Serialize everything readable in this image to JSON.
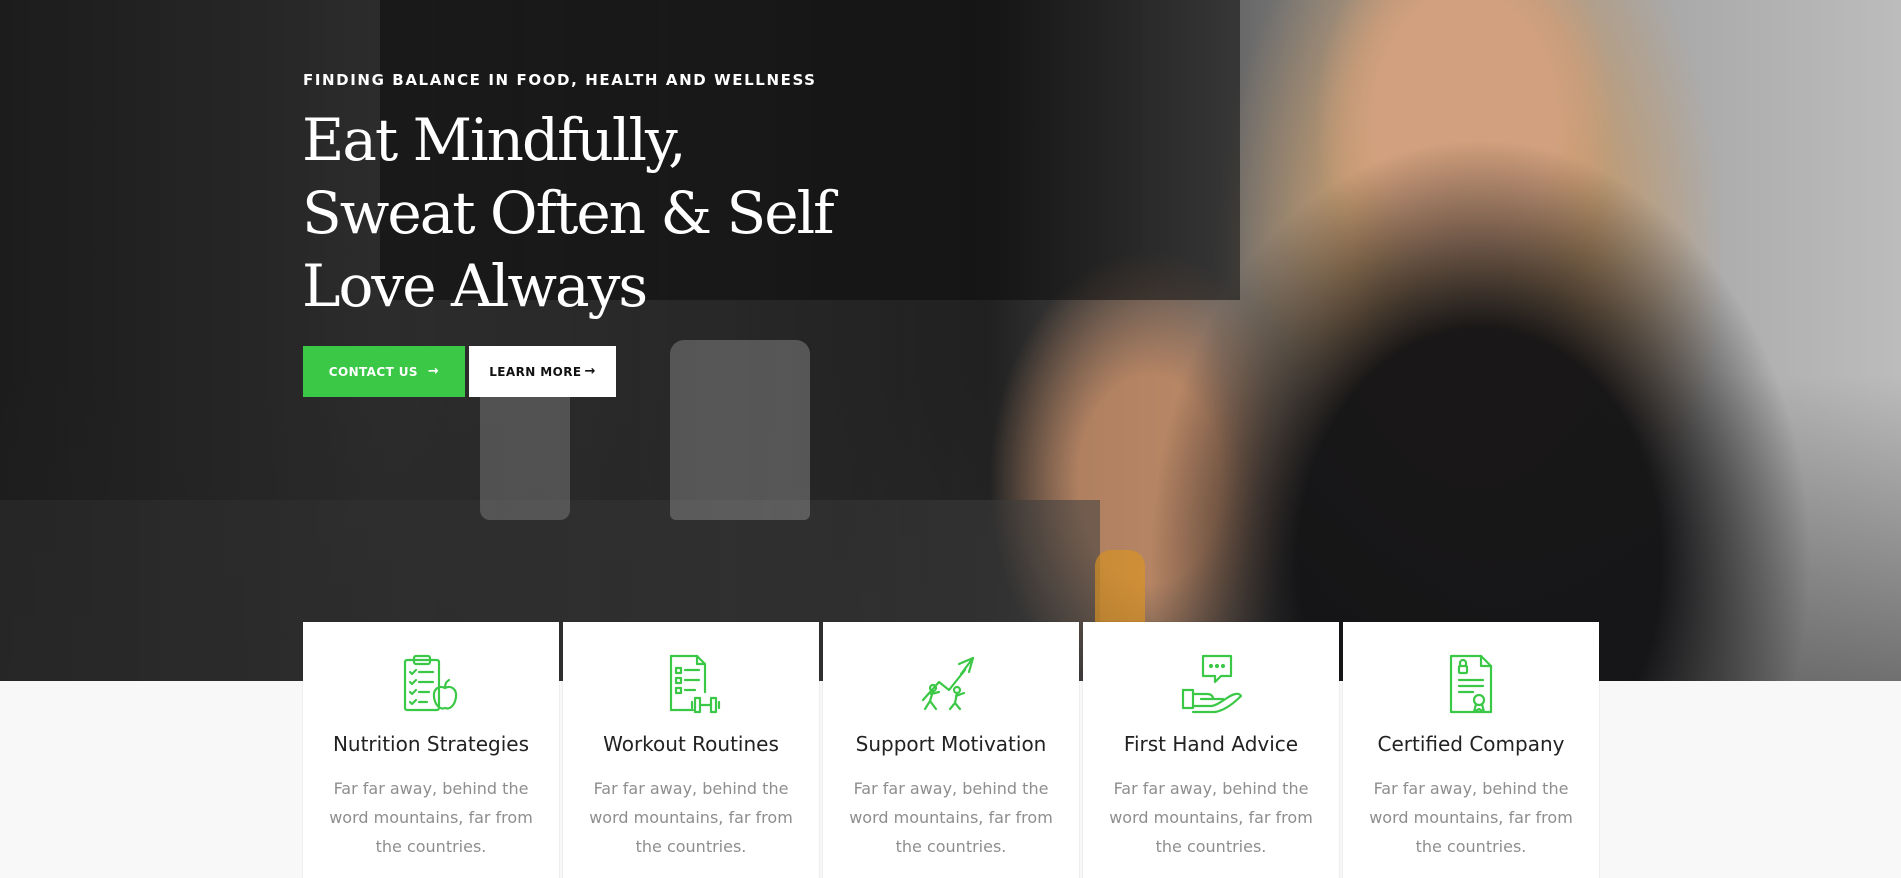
{
  "theme": {
    "accent": "#3cc847",
    "text_dark": "#222222",
    "text_muted": "#8e8e8e"
  },
  "hero": {
    "subtitle": "FINDING BALANCE IN FOOD, HEALTH AND WELLNESS",
    "headline_lines": [
      "Eat Mindfully,",
      "Sweat Often & Self",
      "Love Always"
    ],
    "buttons": {
      "contact": {
        "label": "CONTACT US",
        "arrow": "→"
      },
      "learn": {
        "label": "LEARN MORE",
        "arrow": "→"
      }
    }
  },
  "features": [
    {
      "icon": "clipboard-apple-icon",
      "title": "Nutrition Strategies",
      "text": "Far far away, behind the word mountains, far from the countries."
    },
    {
      "icon": "checklist-dumbbell-icon",
      "title": "Workout Routines",
      "text": "Far far away, behind the word mountains, far from the countries."
    },
    {
      "icon": "climbing-arrow-icon",
      "title": "Support Motivation",
      "text": "Far far away, behind the word mountains, far from the countries."
    },
    {
      "icon": "hand-chat-icon",
      "title": "First Hand Advice",
      "text": "Far far away, behind the word mountains, far from the countries."
    },
    {
      "icon": "certificate-icon",
      "title": "Certified Company",
      "text": "Far far away, behind the word mountains, far from the countries."
    }
  ]
}
